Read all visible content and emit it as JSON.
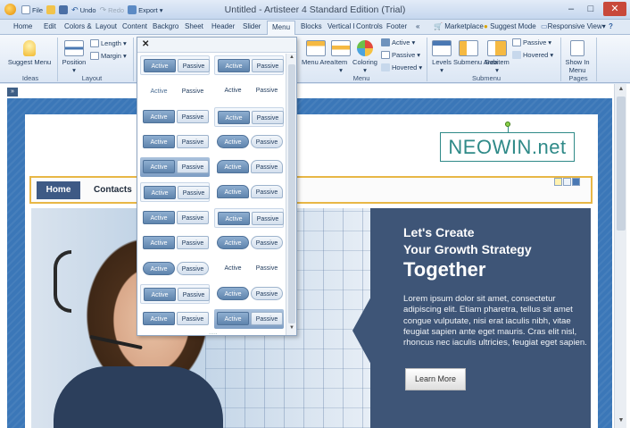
{
  "window": {
    "title": "Untitled - Artisteer 4 Standard Edition (Trial)",
    "quick_access": [
      {
        "label": "File",
        "icon": "file-icon",
        "disabled": false
      },
      {
        "label": "",
        "icon": "open-icon",
        "disabled": false
      },
      {
        "label": "",
        "icon": "save-icon",
        "disabled": false
      },
      {
        "label": "Undo",
        "icon": "undo-icon",
        "disabled": false
      },
      {
        "label": "Redo",
        "icon": "redo-icon",
        "disabled": true
      },
      {
        "label": "Export",
        "icon": "export-icon",
        "disabled": false
      }
    ],
    "controls": {
      "minimize": "–",
      "maximize": "□",
      "close": "✕"
    }
  },
  "tabs": [
    {
      "label": "Home",
      "active": false
    },
    {
      "label": "Edit",
      "active": false
    },
    {
      "label": "Colors &",
      "active": false
    },
    {
      "label": "Layout",
      "active": false
    },
    {
      "label": "Content",
      "active": false
    },
    {
      "label": "Backgro",
      "active": false
    },
    {
      "label": "Sheet",
      "active": false
    },
    {
      "label": "Header",
      "active": false
    },
    {
      "label": "Slider",
      "active": false
    },
    {
      "label": "Menu",
      "active": true
    },
    {
      "label": "Blocks",
      "active": false
    },
    {
      "label": "Vertical I",
      "active": false
    },
    {
      "label": "Controls",
      "active": false
    },
    {
      "label": "Footer",
      "active": false
    },
    {
      "label": "«",
      "active": false
    }
  ],
  "tabs_right": {
    "marketplace": "Marketplace",
    "suggest_mode": "Suggest Mode",
    "responsive_view": "Responsive View",
    "help": "?"
  },
  "ribbon": {
    "ideas": {
      "suggest_menu": "Suggest Menu",
      "group": "Ideas"
    },
    "layout": {
      "position": "Position",
      "length": "Length",
      "margin": "Margin",
      "group": "Layout"
    },
    "menu": {
      "menu_area": "Menu Area",
      "item": "Item",
      "coloring": "Coloring",
      "active": "Active",
      "passive": "Passive",
      "hovered": "Hovered",
      "group": "Menu"
    },
    "submenu": {
      "levels": "Levels",
      "submenu_area": "Submenu Area",
      "subitem": "Subitem",
      "passive": "Passive",
      "hovered": "Hovered",
      "group": "Submenu"
    },
    "pages": {
      "show_in_menu": "Show In Menu",
      "group": "Pages"
    }
  },
  "popup": {
    "close": "✕",
    "active_label": "Active",
    "passive_label": "Passive",
    "grip": "....."
  },
  "site": {
    "logo": "NEOWIN.net",
    "menu_items": [
      "Home",
      "Contacts"
    ],
    "hero": {
      "line1": "Let's Create",
      "line2": "Your Growth Strategy",
      "line3": "Together",
      "body": "Lorem ipsum dolor sit amet, consectetur adipiscing elit. Etiam pharetra, tellus sit amet congue vulputate, nisi erat iaculis nibh, vitae feugiat sapien ante eget mauris. Cras elit nisl, rhoncus nec iaculis ultricies, feugiat eget sapien.",
      "button": "Learn More"
    },
    "panel_toggle": "»"
  },
  "colors": {
    "accent": "#3e5577",
    "menu_active": "#3e5a85",
    "logo": "#2f8a88",
    "menu_border": "#e8b746"
  }
}
